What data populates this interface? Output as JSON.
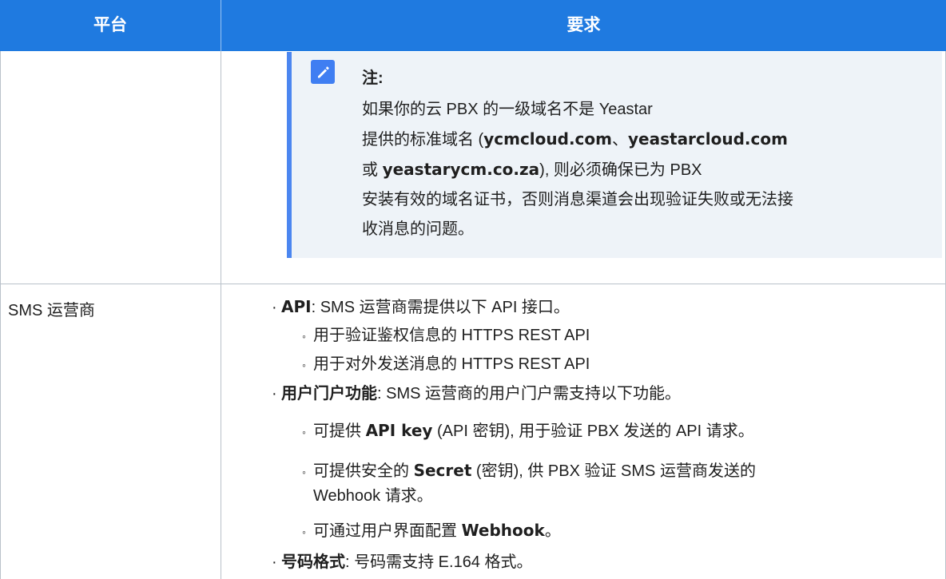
{
  "header": {
    "col_platform": "平台",
    "col_requirements": "要求"
  },
  "note": {
    "title": "注:",
    "line1": "如果你的云 PBX 的一级域名不是 Yeastar",
    "line2_prefix": "提供的标准域名 (",
    "domain1": "ycmcloud.com",
    "sep1": "、",
    "domain2": "yeastarcloud.com",
    "line3_prefix": "或 ",
    "domain3": "yeastarycm.co.za",
    "line3_suffix": "), 则必须确保已为 PBX",
    "line4": "安装有效的域名证书，否则消息渠道会出现验证失败或无法接",
    "line5": "收消息的问题。"
  },
  "row_sms": {
    "platform": "SMS 运营商",
    "bullet": "·",
    "sub_bullet": "◦",
    "api_label": "API",
    "api_text": ": SMS 运营商需提供以下 API 接口。",
    "api_sub1": "用于验证鉴权信息的 HTTPS REST API",
    "api_sub2": "用于对外发送消息的 HTTPS REST API",
    "portal_label": "用户门户功能",
    "portal_text": ": SMS 运营商的用户门户需支持以下功能。",
    "portal_sub1_prefix": "可提供 ",
    "portal_sub1_bold": "API key",
    "portal_sub1_suffix": " (API 密钥), 用于验证 PBX 发送的 API 请求。",
    "portal_sub2_prefix": "可提供安全的 ",
    "portal_sub2_bold": "Secret",
    "portal_sub2_suffix": " (密钥), 供 PBX 验证 SMS 运营商发送的",
    "portal_sub2_line2": "Webhook 请求。",
    "portal_sub3_prefix": "可通过用户界面配置 ",
    "portal_sub3_bold": "Webhook",
    "portal_sub3_suffix": "。",
    "format_label": "号码格式",
    "format_text": ": 号码需支持 E.164 格式。"
  },
  "colors": {
    "header_bg": "#1f7ae0",
    "note_bg": "#eef3f8",
    "note_accent": "#4b86f0",
    "grid_line": "#b9c1ca"
  },
  "icons": {
    "note": "pencil-edit-icon"
  }
}
